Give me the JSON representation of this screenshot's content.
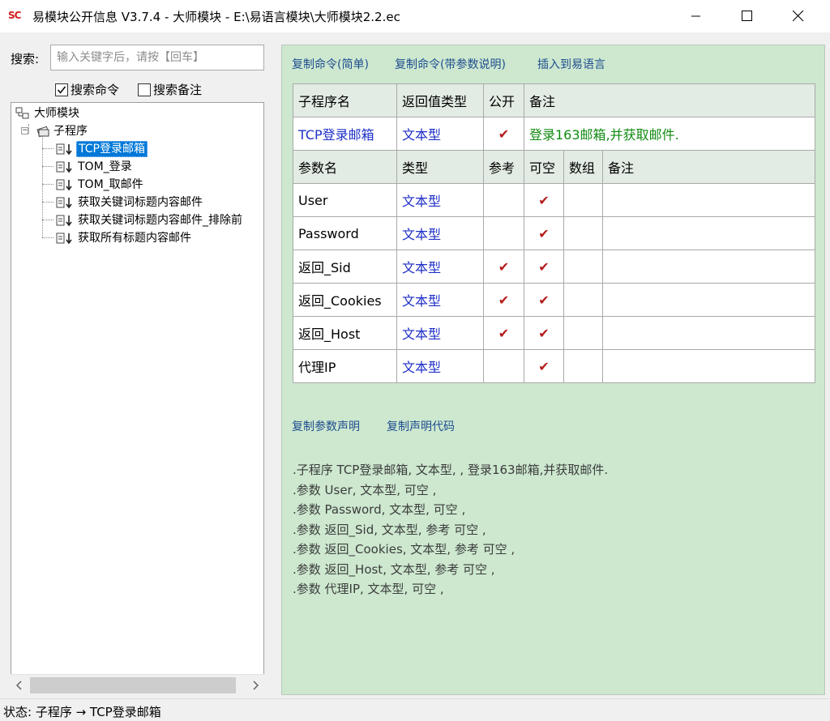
{
  "window": {
    "title": "易模块公开信息 V3.7.4 - 大师模块 - E:\\易语言模块\\大师模块2.2.ec",
    "icon_text": "SC",
    "minimize_icon": "minimize-icon",
    "maximize_icon": "maximize-icon",
    "close_icon": "close-icon"
  },
  "search": {
    "label": "搜索:",
    "placeholder": "输入关键字后，请按【回车】",
    "value": "",
    "opt_command": {
      "label": "搜索命令",
      "checked": true
    },
    "opt_note": {
      "label": "搜索备注",
      "checked": false
    }
  },
  "tree": {
    "root": "大师模块",
    "group": "子程序",
    "items": [
      {
        "label": "TCP登录邮箱",
        "selected": true
      },
      {
        "label": "TOM_登录",
        "selected": false
      },
      {
        "label": "TOM_取邮件",
        "selected": false
      },
      {
        "label": "获取关键词标题内容邮件",
        "selected": false
      },
      {
        "label": "获取关键词标题内容邮件_排除前",
        "selected": false
      },
      {
        "label": "获取所有标题内容邮件",
        "selected": false
      }
    ]
  },
  "links_top": {
    "copy_simple": "复制命令(简单)",
    "copy_with_params": "复制命令(带参数说明)",
    "insert": "插入到易语言"
  },
  "routine_table": {
    "headers": [
      "子程序名",
      "返回值类型",
      "公开",
      "备注"
    ],
    "row": {
      "name": "TCP登录邮箱",
      "return_type": "文本型",
      "public": "✔",
      "note": "登录163邮箱,并获取邮件."
    }
  },
  "param_table": {
    "headers": [
      "参数名",
      "类型",
      "参考",
      "可空",
      "数组",
      "备注"
    ],
    "rows": [
      {
        "name": "User",
        "type": "文本型",
        "ref": "",
        "nullable": "✔",
        "array": "",
        "note": ""
      },
      {
        "name": "Password",
        "type": "文本型",
        "ref": "",
        "nullable": "✔",
        "array": "",
        "note": ""
      },
      {
        "name": "返回_Sid",
        "type": "文本型",
        "ref": "✔",
        "nullable": "✔",
        "array": "",
        "note": ""
      },
      {
        "name": "返回_Cookies",
        "type": "文本型",
        "ref": "✔",
        "nullable": "✔",
        "array": "",
        "note": ""
      },
      {
        "name": "返回_Host",
        "type": "文本型",
        "ref": "✔",
        "nullable": "✔",
        "array": "",
        "note": ""
      },
      {
        "name": "代理IP",
        "type": "文本型",
        "ref": "",
        "nullable": "✔",
        "array": "",
        "note": ""
      }
    ]
  },
  "links_mid": {
    "copy_param_decl": "复制参数声明",
    "copy_decl_code": "复制声明代码"
  },
  "declaration": [
    ".子程序 TCP登录邮箱, 文本型, , 登录163邮箱,并获取邮件.",
    ".参数 User, 文本型, 可空 ,",
    ".参数 Password, 文本型, 可空 ,",
    ".参数 返回_Sid, 文本型, 参考 可空 ,",
    ".参数 返回_Cookies, 文本型, 参考 可空 ,",
    ".参数 返回_Host, 文本型, 参考 可空 ,",
    ".参数 代理IP, 文本型, 可空 ,"
  ],
  "status": {
    "text": "状态: 子程序 → TCP登录邮箱"
  },
  "colors": {
    "panel_bg": "#cde8cf",
    "type_blue": "#1e2fc7",
    "note_green": "#108a10",
    "check_red": "#b41c1c",
    "selection": "#0078d7"
  }
}
